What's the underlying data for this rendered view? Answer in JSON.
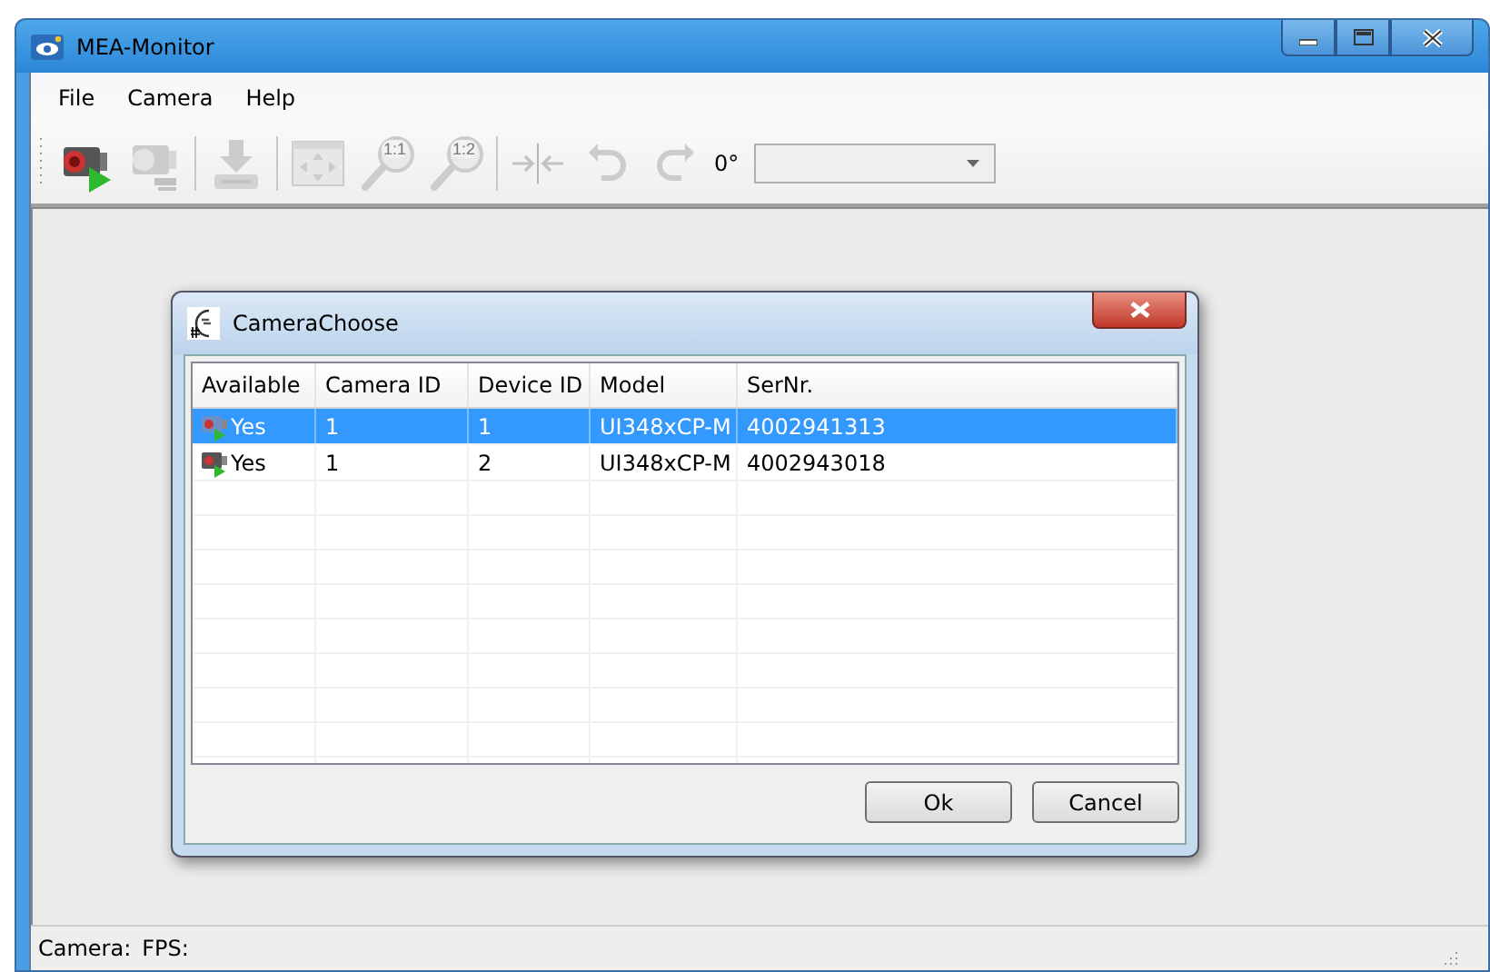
{
  "window": {
    "title": "MEA-Monitor"
  },
  "menu": [
    {
      "label": "File"
    },
    {
      "label": "Camera"
    },
    {
      "label": "Help"
    }
  ],
  "toolbar": [
    {
      "kind": "camera-play",
      "enabled": true
    },
    {
      "kind": "camera-stop",
      "enabled": false
    },
    {
      "kind": "separator"
    },
    {
      "kind": "download",
      "enabled": false
    },
    {
      "kind": "separator"
    },
    {
      "kind": "fit",
      "enabled": false
    },
    {
      "kind": "zoom",
      "text": "1:1",
      "enabled": false
    },
    {
      "kind": "zoom",
      "text": "1:2",
      "enabled": false
    },
    {
      "kind": "separator"
    },
    {
      "kind": "mirror",
      "enabled": false
    },
    {
      "kind": "rotate-left",
      "enabled": false
    },
    {
      "kind": "rotate-right",
      "enabled": false
    }
  ],
  "rotation": {
    "label": "0°"
  },
  "status_bar": [
    {
      "label": "Camera:"
    },
    {
      "label": "FPS:"
    }
  ],
  "dialog": {
    "title": "CameraChoose",
    "columns": [
      "Available",
      "Camera ID",
      "Device ID",
      "Model",
      "SerNr."
    ],
    "rows": [
      {
        "selected": true,
        "cells": [
          "Yes",
          "1",
          "1",
          "UI348xCP-M",
          "4002941313"
        ]
      },
      {
        "selected": false,
        "cells": [
          "Yes",
          "1",
          "2",
          "UI348xCP-M",
          "4002943018"
        ]
      }
    ],
    "buttons": [
      "Ok",
      "Cancel"
    ]
  }
}
